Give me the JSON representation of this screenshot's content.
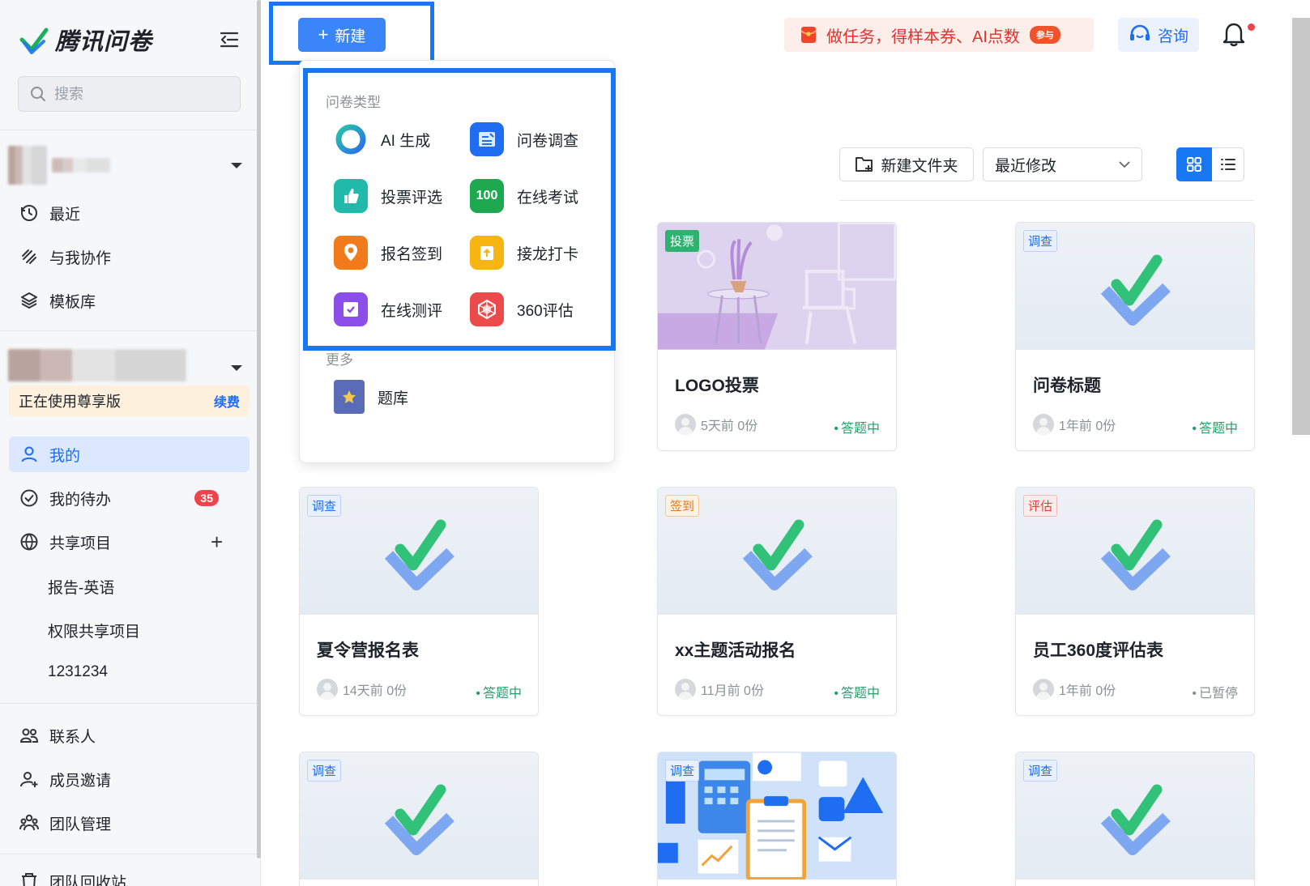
{
  "app": {
    "name": "腾讯问卷"
  },
  "sidebar": {
    "search_placeholder": "搜索",
    "nav_top": [
      {
        "label": "最近",
        "icon": "clock-icon"
      },
      {
        "label": "与我协作",
        "icon": "link-icon"
      },
      {
        "label": "模板库",
        "icon": "layers-icon"
      }
    ],
    "premium": {
      "text": "正在使用尊享版",
      "renew": "续费"
    },
    "nav_team": [
      {
        "label": "我的",
        "icon": "user-icon",
        "active": true
      },
      {
        "label": "我的待办",
        "icon": "check-circle-icon",
        "badge": "35"
      },
      {
        "label": "共享项目",
        "icon": "globe-icon"
      }
    ],
    "shared_projects": [
      "报告-英语",
      "权限共享项目",
      "1231234"
    ],
    "nav_bottom": [
      {
        "label": "联系人",
        "icon": "contacts-icon"
      },
      {
        "label": "成员邀请",
        "icon": "user-add-icon"
      },
      {
        "label": "团队管理",
        "icon": "team-icon"
      },
      {
        "label": "团队回收站",
        "icon": "trash-icon"
      }
    ]
  },
  "topbar": {
    "new_label": "新建",
    "promo_text": "做任务，得样本券、AI点数",
    "promo_tag": "参与",
    "consult_label": "咨询"
  },
  "toolbar": {
    "new_folder_label": "新建文件夹",
    "sort_value": "最近修改"
  },
  "dropdown": {
    "section_types": "问卷类型",
    "types": [
      {
        "label": "AI 生成",
        "icon": "ai-ring-icon"
      },
      {
        "label": "问卷调查",
        "icon": "survey-icon"
      },
      {
        "label": "投票评选",
        "icon": "thumbs-up-icon"
      },
      {
        "label": "在线考试",
        "icon": "score-100-icon"
      },
      {
        "label": "报名签到",
        "icon": "location-pin-icon"
      },
      {
        "label": "接龙打卡",
        "icon": "upload-box-icon"
      },
      {
        "label": "在线测评",
        "icon": "checkbox-icon"
      },
      {
        "label": "360评估",
        "icon": "radar-icon"
      }
    ],
    "section_more": "更多",
    "more": [
      {
        "label": "题库",
        "icon": "book-icon"
      }
    ]
  },
  "cards": [
    {
      "tag": "投票",
      "tag_color": "green",
      "title": "LOGO投票",
      "meta": "5天前 0份",
      "status": "答题中",
      "thumb": "illustration"
    },
    {
      "tag": "调查",
      "tag_color": "blue",
      "title": "问卷标题",
      "meta": "1年前 0份",
      "status": "答题中",
      "thumb": "check"
    },
    {
      "tag": "调查",
      "tag_color": "blue",
      "title": "夏令营报名表",
      "meta": "14天前 0份",
      "status": "答题中",
      "thumb": "check"
    },
    {
      "tag": "签到",
      "tag_color": "orange",
      "title": "xx主题活动报名",
      "meta": "11月前 0份",
      "status": "答题中",
      "thumb": "check"
    },
    {
      "tag": "评估",
      "tag_color": "red",
      "title": "员工360度评估表",
      "meta": "1年前 0份",
      "status": "已暂停",
      "thumb": "check"
    },
    {
      "tag": "调查",
      "tag_color": "blue",
      "title": "",
      "meta": "",
      "status": "",
      "thumb": "check"
    },
    {
      "tag": "调查",
      "tag_color": "blue",
      "title": "",
      "meta": "",
      "status": "",
      "thumb": "office"
    },
    {
      "tag": "调查",
      "tag_color": "blue",
      "title": "",
      "meta": "",
      "status": "",
      "thumb": "check"
    }
  ]
}
